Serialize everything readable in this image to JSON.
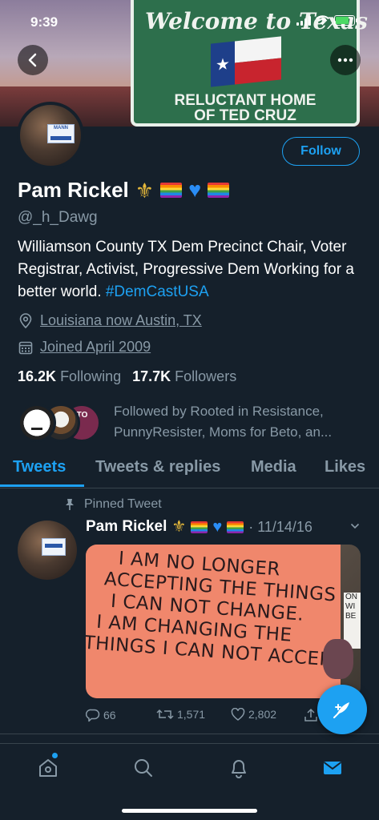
{
  "status_bar": {
    "time": "9:39"
  },
  "header": {
    "sign_top": "Welcome to Texas",
    "sign_line1": "RELUCTANT HOME",
    "sign_line2": "OF TED CRUZ",
    "back_icon": "chevron-left-icon",
    "more_icon": "more-horizontal-icon"
  },
  "profile": {
    "name": "Pam Rickel",
    "handle": "@_h_Dawg",
    "bio_text": "Williamson County TX Dem Precinct Chair, Voter Registrar, Activist, Progressive Dem Working for a better world.",
    "bio_hashtag": "#DemCastUSA",
    "location": "Louisiana now Austin, TX",
    "joined": "Joined April 2009",
    "following_count": "16.2K",
    "following_label": "Following",
    "followers_count": "17.7K",
    "followers_label": "Followers",
    "followed_by": "Followed by Rooted in Resistance, PunnyResister, Moms for Beto, an...",
    "follow_button": "Follow",
    "avatar_card_text": "MANN",
    "followed_avatar3_text": "ETO"
  },
  "tabs": [
    {
      "label": "Tweets",
      "active": true
    },
    {
      "label": "Tweets & replies",
      "active": false
    },
    {
      "label": "Media",
      "active": false
    },
    {
      "label": "Likes",
      "active": false
    }
  ],
  "tweet": {
    "pinned_label": "Pinned Tweet",
    "name": "Pam Rickel",
    "date": "· 11/14/16",
    "image_text": [
      "I AM NO LONGER",
      "ACCEPTING THE THINGS",
      "I CAN NOT CHANGE.",
      "I AM CHANGING THE",
      "THINGS I CAN NOT ACCEPT"
    ],
    "side_sign_text": [
      "ON",
      "WI",
      "BE"
    ],
    "replies": "66",
    "retweets": "1,571",
    "likes": "2,802"
  },
  "bottom_nav": [
    "home-icon",
    "search-icon",
    "bell-icon",
    "mail-icon"
  ],
  "colors": {
    "accent": "#1da1f2",
    "background": "#15202b",
    "muted": "#8899a6",
    "divider": "#38444d"
  }
}
